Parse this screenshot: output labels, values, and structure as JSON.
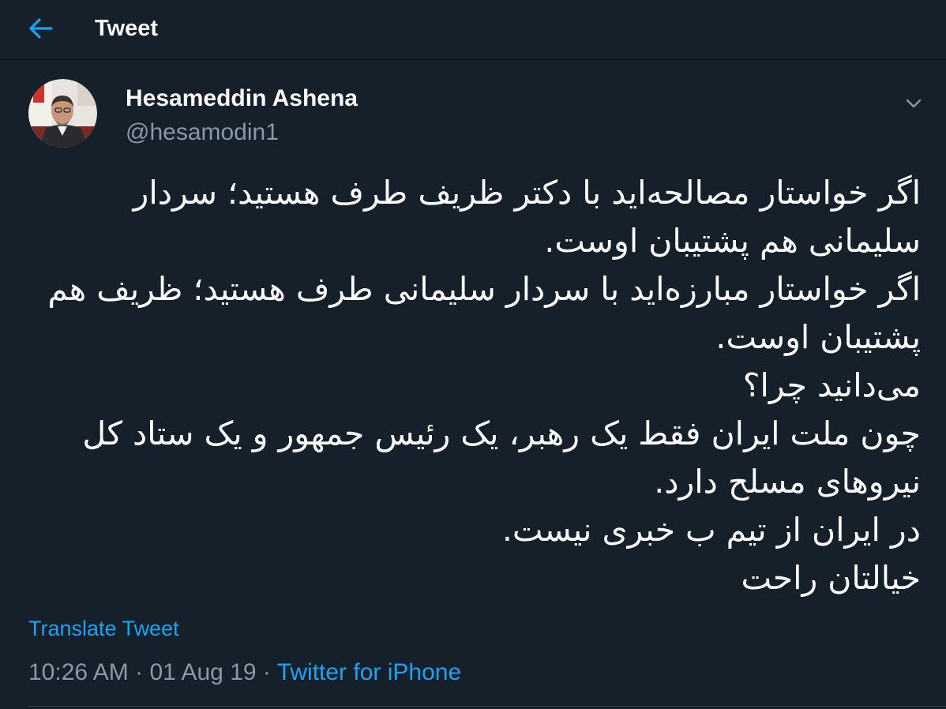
{
  "header": {
    "title": "Tweet",
    "back_icon": "arrow-left-icon",
    "accent_color": "#1da1f2"
  },
  "author": {
    "name": "Hesameddin Ashena",
    "handle": "@hesamodin1",
    "avatar_icon": "avatar-photo"
  },
  "menu": {
    "caret_icon": "chevron-down-icon"
  },
  "tweet": {
    "lines": [
      "اگر خواستار مصالحه‌اید با دکتر ظریف طرف هستید؛ سردار",
      "سلیمانی هم پشتیبان اوست.",
      "اگر خواستار مبارزه‌اید با سردار سلیمانی طرف هستید؛ ظریف هم",
      "پشتیبان اوست.",
      "می‌دانید چرا؟",
      "چون ملت ایران فقط یک رهبر، یک رئیس جمهور و یک ستاد کل",
      "نیروهای مسلح دارد.",
      "در ایران از تیم ب خبری نیست.",
      "خیالتان راحت"
    ]
  },
  "translate": {
    "label": "Translate Tweet"
  },
  "meta": {
    "time": "10:26 AM",
    "separator": " · ",
    "date": "01 Aug 19",
    "source": "Twitter for iPhone"
  },
  "colors": {
    "background": "#15202b",
    "text": "#ffffff",
    "muted": "#8899a6",
    "link": "#1da1f2"
  }
}
